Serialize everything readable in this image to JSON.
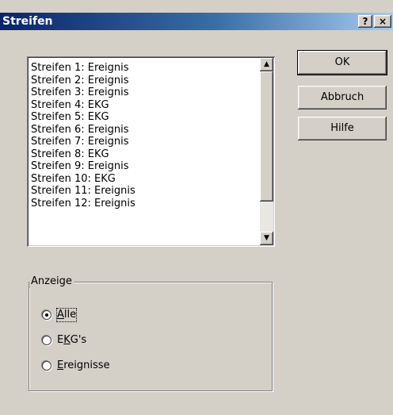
{
  "window": {
    "title": "Streifen",
    "help_glyph": "?",
    "close_glyph": "×"
  },
  "list": {
    "items": [
      "Streifen 1: Ereignis",
      "Streifen 2: Ereignis",
      "Streifen 3: Ereignis",
      "Streifen 4: EKG",
      "Streifen 5: EKG",
      "Streifen 6: Ereignis",
      "Streifen 7: Ereignis",
      "Streifen 8: EKG",
      "Streifen 9: Ereignis",
      "Streifen 10: EKG",
      "Streifen 11: Ereignis",
      "Streifen 12: Ereignis"
    ],
    "scroll_up_glyph": "▲",
    "scroll_down_glyph": "▼"
  },
  "buttons": {
    "ok": "OK",
    "cancel": "Abbruch",
    "help": "Hilfe"
  },
  "anzeige": {
    "label": "Anzeige",
    "options": [
      {
        "mnemonic": "A",
        "rest": "lle",
        "pre": "",
        "selected": true
      },
      {
        "pre": "E",
        "mnemonic": "K",
        "rest": "G's",
        "selected": false
      },
      {
        "pre": "",
        "mnemonic": "E",
        "rest": "reignisse",
        "selected": false
      }
    ]
  }
}
